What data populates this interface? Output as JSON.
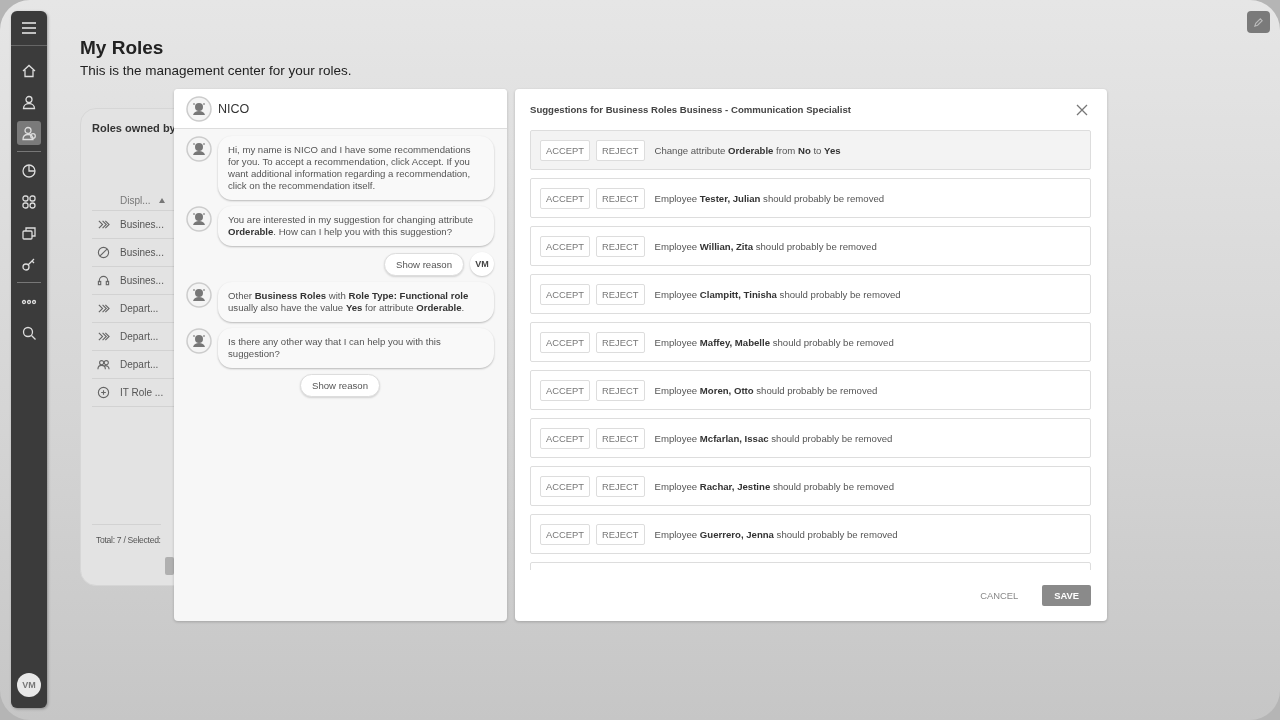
{
  "sidebar": {
    "items": [
      {
        "selected": false
      },
      {
        "selected": false
      },
      {
        "selected": true
      },
      {
        "selected": false
      },
      {
        "selected": false
      },
      {
        "selected": false
      },
      {
        "selected": false
      },
      {
        "selected": false
      },
      {
        "selected": false
      }
    ],
    "avatar": "VM"
  },
  "page": {
    "title": "My Roles",
    "subtitle": "This is the management center for your roles."
  },
  "roles_card": {
    "title": "Roles owned by",
    "column_1": "Displ...",
    "rows": [
      {
        "name": "Busines..."
      },
      {
        "name": "Busines..."
      },
      {
        "name": "Busines..."
      },
      {
        "name": "Depart..."
      },
      {
        "name": "Depart..."
      },
      {
        "name": "Depart..."
      },
      {
        "name": "IT Role ..."
      }
    ],
    "footer": "Total: 7 / Selected:"
  },
  "chat": {
    "title": "NICO",
    "messages": [
      {
        "kind": "bot",
        "text": "Hi, my name is NICO and I have some recommendations for you. To accept a recommendation, click Accept. If you want additional information regarding a recommendation, click on the recommendation itself."
      },
      {
        "kind": "bot",
        "text": "You are interested in my suggestion for changing attribute **Orderable**. How can I help you with this suggestion?"
      },
      {
        "kind": "user",
        "text": "Show reason",
        "avatar": "VM"
      },
      {
        "kind": "bot",
        "text": "Other **Business Roles** with **Role Type: Functional role** usually also have the value **Yes** for attribute **Orderable**."
      },
      {
        "kind": "bot",
        "text": "Is there any other way that I can help you with this suggestion?"
      },
      {
        "kind": "action",
        "text": "Show reason"
      }
    ]
  },
  "suggestions": {
    "title": "Suggestions for Business Roles Business - Communication Specialist",
    "items": [
      {
        "text": "Change attribute **Orderable** from **No** to **Yes**",
        "selected": true,
        "accept": "ACCEPT",
        "reject": "REJECT"
      },
      {
        "text": "Employee **Tester, Julian** should probably be removed",
        "selected": false,
        "accept": "ACCEPT",
        "reject": "REJECT"
      },
      {
        "text": "Employee **Willian, Zita** should probably be removed",
        "selected": false,
        "accept": "ACCEPT",
        "reject": "REJECT"
      },
      {
        "text": "Employee **Clampitt, Tinisha** should probably be removed",
        "selected": false,
        "accept": "ACCEPT",
        "reject": "REJECT"
      },
      {
        "text": "Employee **Maffey, Mabelle** should probably be removed",
        "selected": false,
        "accept": "ACCEPT",
        "reject": "REJECT"
      },
      {
        "text": "Employee **Moren, Otto** should probably be removed",
        "selected": false,
        "accept": "ACCEPT",
        "reject": "REJECT"
      },
      {
        "text": "Employee **Mcfarlan, Issac** should probably be removed",
        "selected": false,
        "accept": "ACCEPT",
        "reject": "REJECT"
      },
      {
        "text": "Employee **Rachar, Jestine** should probably be removed",
        "selected": false,
        "accept": "ACCEPT",
        "reject": "REJECT"
      },
      {
        "text": "Employee **Guerrero, Jenna** should probably be removed",
        "selected": false,
        "accept": "ACCEPT",
        "reject": "REJECT"
      }
    ],
    "cancel": "CANCEL",
    "save": "SAVE"
  }
}
